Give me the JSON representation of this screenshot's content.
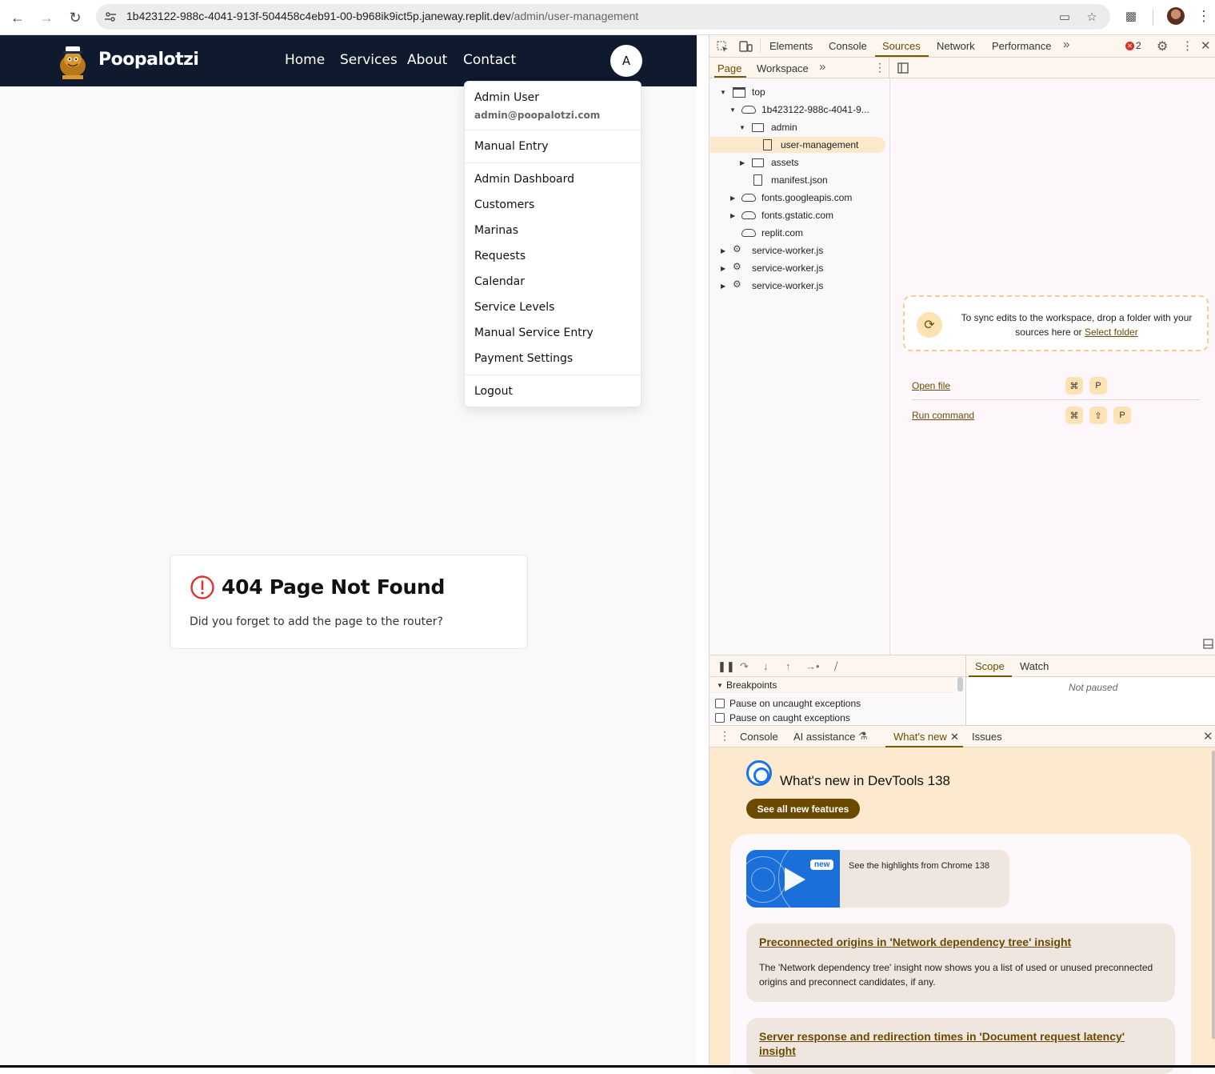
{
  "browser": {
    "url_host": "1b423122-988c-4041-913f-504458c4eb91-00-b968ik9ict5p.janeway.replit.dev",
    "url_path": "/admin/user-management"
  },
  "app": {
    "brand": "Poopalotzi",
    "nav": [
      "Home",
      "Services",
      "About",
      "Contact"
    ],
    "avatar_letter": "A",
    "menu": {
      "name": "Admin User",
      "email": "admin@poopalotzi.com",
      "manual_entry": "Manual Entry",
      "items": [
        "Admin Dashboard",
        "Customers",
        "Marinas",
        "Requests",
        "Calendar",
        "Service Levels",
        "Manual Service Entry",
        "Payment Settings"
      ],
      "logout": "Logout"
    },
    "error_card": {
      "title": "404 Page Not Found",
      "message": "Did you forget to add the page to the router?"
    }
  },
  "devtools": {
    "tabs": [
      "Elements",
      "Console",
      "Sources",
      "Network",
      "Performance"
    ],
    "active_tab": "Sources",
    "error_count": "2",
    "subtabs": [
      "Page",
      "Workspace"
    ],
    "tree": {
      "top": "top",
      "origin": "1b423122-988c-4041-9...",
      "admin": "admin",
      "file_selected": "user-management",
      "assets": "assets",
      "manifest": "manifest.json",
      "googleapis": "fonts.googleapis.com",
      "gstatic": "fonts.gstatic.com",
      "replit": "replit.com",
      "sw1": "service-worker.js",
      "sw2": "service-worker.js",
      "sw3": "service-worker.js"
    },
    "sync": {
      "text": "To sync edits to the workspace, drop a folder with your sources here or",
      "link": "Select folder"
    },
    "shortcuts": {
      "open_file": "Open file",
      "run_command": "Run command",
      "cmd": "⌘",
      "shift": "⇧",
      "p": "P"
    },
    "debugger": {
      "breakpoints": "Breakpoints",
      "pause_uncaught": "Pause on uncaught exceptions",
      "pause_caught": "Pause on caught exceptions",
      "scope": "Scope",
      "watch": "Watch",
      "not_paused": "Not paused"
    },
    "drawer": {
      "tabs": [
        "Console",
        "AI assistance",
        "What's new",
        "Issues"
      ],
      "title": "What's new in DevTools 138",
      "see_all": "See all new features",
      "video_badge": "new",
      "video_text": "See the highlights from Chrome 138",
      "features": [
        {
          "title": "Preconnected origins in 'Network dependency tree' insight",
          "desc": "The 'Network dependency tree' insight now shows you a list of used or unused preconnected origins and preconnect candidates, if any."
        },
        {
          "title": "Server response and redirection times in 'Document request latency' insight",
          "desc": ""
        }
      ]
    }
  }
}
